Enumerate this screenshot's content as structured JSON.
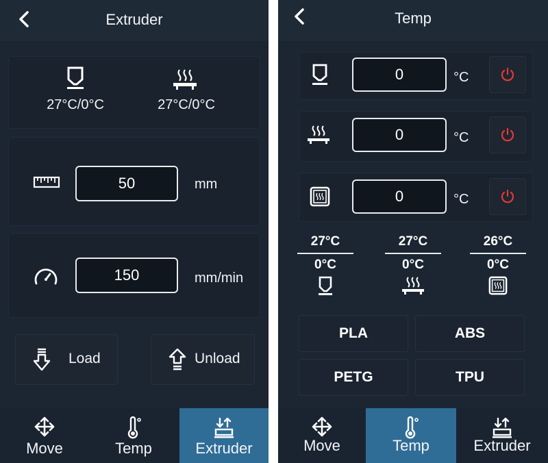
{
  "left_screen": {
    "title": "Extruder",
    "nozzle_temp": "27°C/0°C",
    "bed_temp": "27°C/0°C",
    "length": {
      "value": "50",
      "unit": "mm"
    },
    "speed": {
      "value": "150",
      "unit": "mm/min"
    },
    "load_label": "Load",
    "unload_label": "Unload",
    "nav": [
      {
        "label": "Move",
        "icon": "move-arrows-icon",
        "active": false
      },
      {
        "label": "Temp",
        "icon": "thermometer-icon",
        "active": false
      },
      {
        "label": "Extruder",
        "icon": "extruder-icon",
        "active": true
      }
    ]
  },
  "right_screen": {
    "title": "Temp",
    "nozzle": {
      "value": "0",
      "unit": "°C"
    },
    "bed": {
      "value": "0",
      "unit": "°C"
    },
    "chamber": {
      "value": "0",
      "unit": "°C"
    },
    "stats": [
      {
        "current": "27°C",
        "target": "0°C",
        "icon": "nozzle-icon"
      },
      {
        "current": "27°C",
        "target": "0°C",
        "icon": "heated-bed-icon"
      },
      {
        "current": "26°C",
        "target": "0°C",
        "icon": "chamber-heater-icon"
      }
    ],
    "presets": [
      "PLA",
      "ABS",
      "PETG",
      "TPU"
    ],
    "nav": [
      {
        "label": "Move",
        "icon": "move-arrows-icon",
        "active": false
      },
      {
        "label": "Temp",
        "icon": "thermometer-icon",
        "active": true
      },
      {
        "label": "Extruder",
        "icon": "extruder-icon",
        "active": false
      }
    ]
  },
  "colors": {
    "background": "#1c2632",
    "active_nav": "#2f6d96",
    "power_icon": "#e53935",
    "text": "#f2f4f6"
  }
}
